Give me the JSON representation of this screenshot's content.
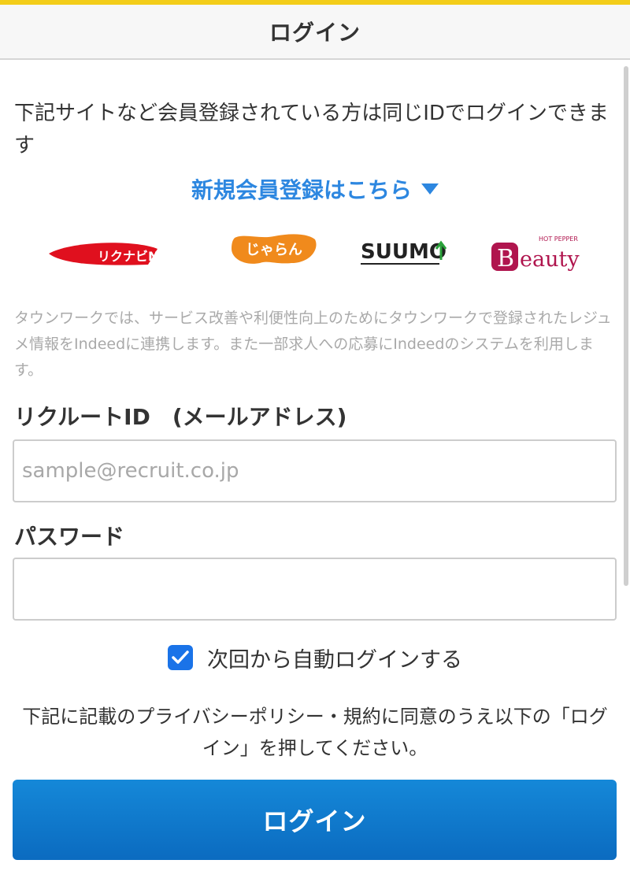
{
  "header": {
    "title": "ログイン"
  },
  "intro": {
    "text": "下記サイトなど会員登録されている方は同じIDでログインできます"
  },
  "register": {
    "link_text": "新規会員登録はこちら",
    "icon": "triangle-down-icon"
  },
  "logos": {
    "rikunabi": "リクナビNEXT",
    "jalan": "じゃらん",
    "suumo": "SUUMO",
    "beauty_top": "HOT PEPPER",
    "beauty": "Beauty"
  },
  "notice": {
    "text": "タウンワークでは、サービス改善や利便性向上のためにタウンワークで登録されたレジュメ情報をIndeedに連携します。また一部求人への応募にIndeedのシステムを利用します。"
  },
  "form": {
    "id_label": "リクルートID　(メールアドレス)",
    "id_placeholder": "sample@recruit.co.jp",
    "password_label": "パスワード",
    "password_value": "",
    "auto_login_label": "次回から自動ログインする",
    "auto_login_checked": true
  },
  "terms": {
    "text": "下記に記載のプライバシーポリシー・規約に同意のうえ以下の「ログイン」を押してください。"
  },
  "login_button": {
    "label": "ログイン"
  },
  "colors": {
    "accent": "#f3cd19",
    "link": "#2d87e0",
    "button": "#0b6bc0"
  }
}
